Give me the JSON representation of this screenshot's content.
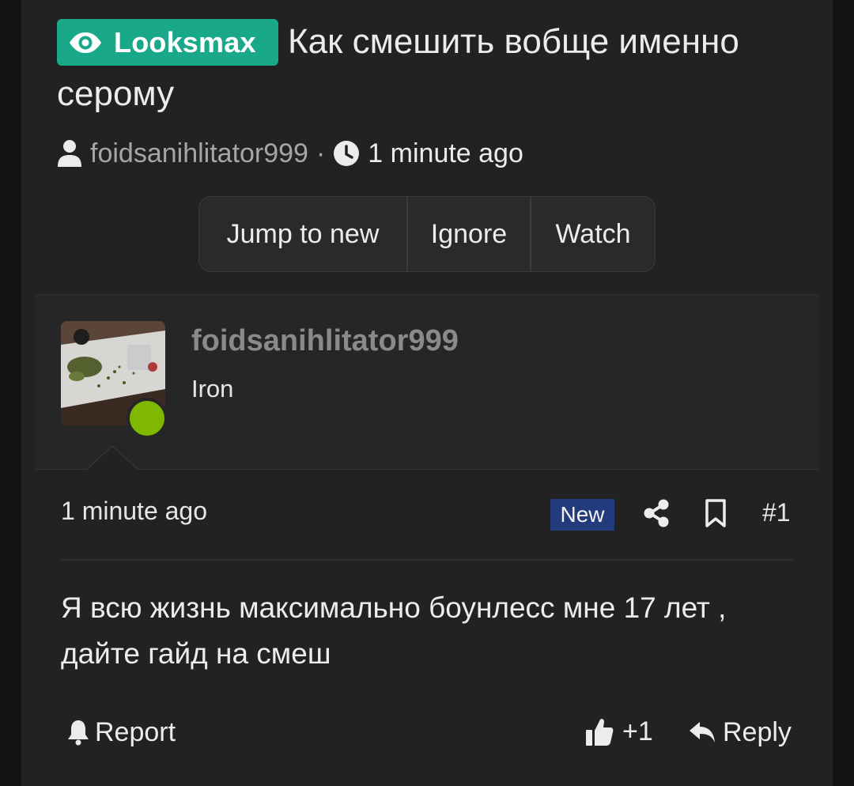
{
  "thread": {
    "prefix": "Looksmax",
    "title": "Как смешить вобще именно серому",
    "author": "foidsanihlitator999",
    "separator": "·",
    "time": "1 minute ago"
  },
  "actions": {
    "jump_to_new": "Jump to new",
    "ignore": "Ignore",
    "watch": "Watch"
  },
  "post": {
    "username": "foidsanihlitator999",
    "user_title": "Iron",
    "online": true,
    "time": "1 minute ago",
    "badge": "New",
    "number": "#1",
    "body": "Я всю жизнь максимально боунлесс мне 17 лет , дайте гайд на смеш",
    "report": "Report",
    "likes": "+1",
    "reply": "Reply"
  },
  "colors": {
    "prefix_bg": "#19a98a",
    "online": "#7fb800",
    "new_badge": "#223b7c",
    "background": "#222222"
  },
  "icons": [
    "eye-icon",
    "user-icon",
    "clock-icon",
    "share-icon",
    "bookmark-icon",
    "bell-icon",
    "thumbs-up-icon",
    "reply-icon"
  ]
}
